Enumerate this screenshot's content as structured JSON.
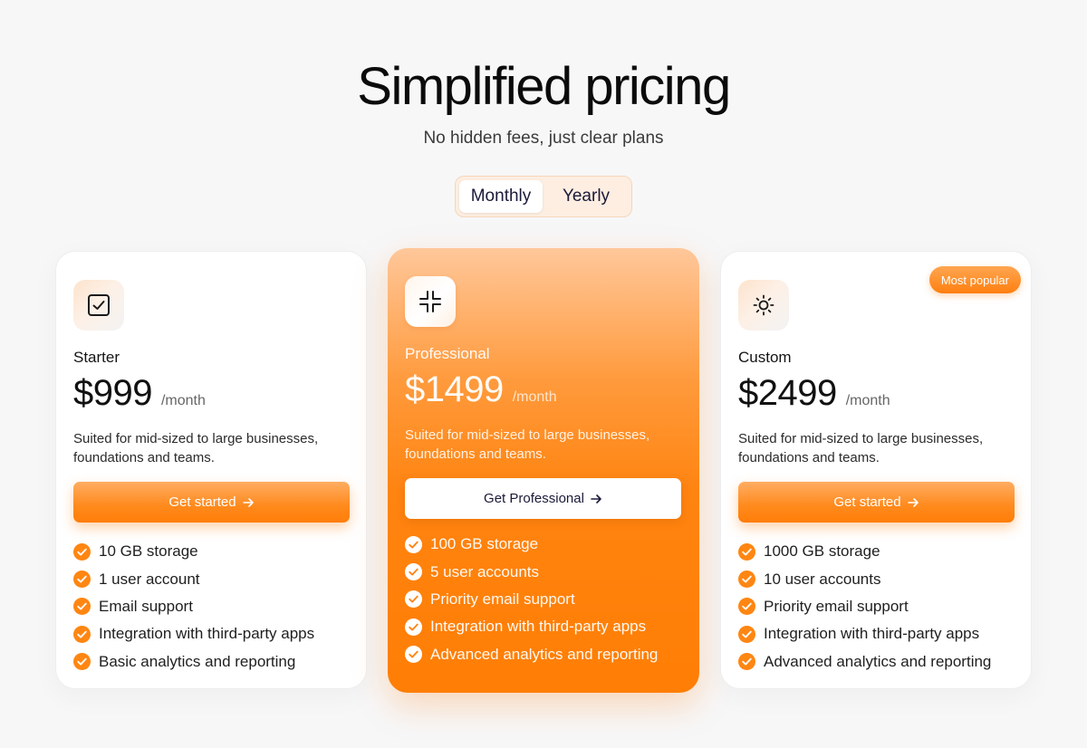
{
  "header": {
    "title": "Simplified pricing",
    "subtitle": "No hidden fees, just clear plans"
  },
  "billing_toggle": {
    "options": [
      "Monthly",
      "Yearly"
    ],
    "selected": "Monthly"
  },
  "colors": {
    "accent": "#ff8410",
    "background": "#f7f7f8"
  },
  "plans": [
    {
      "icon": "checkbox-icon",
      "name": "Starter",
      "price": "$999",
      "period": "/month",
      "description": "Suited for mid-sized to large businesses, foundations and teams.",
      "cta": "Get started",
      "features": [
        "10 GB storage",
        "1 user account",
        "Email support",
        "Integration with third-party apps",
        "Basic analytics and reporting"
      ]
    },
    {
      "icon": "collapse-icon",
      "name": "Professional",
      "price": "$1499",
      "period": "/month",
      "description": "Suited for mid-sized to large businesses, foundations and teams.",
      "cta": "Get Professional",
      "features": [
        "100 GB storage",
        "5 user accounts",
        "Priority email support",
        "Integration with third-party apps",
        "Advanced analytics and reporting"
      ]
    },
    {
      "icon": "sun-icon",
      "name": "Custom",
      "badge": "Most popular",
      "price": "$2499",
      "period": "/month",
      "description": "Suited for mid-sized to large businesses, foundations and teams.",
      "cta": "Get started",
      "features": [
        "1000 GB storage",
        "10 user accounts",
        "Priority email support",
        "Integration with third-party apps",
        "Advanced analytics and reporting"
      ]
    }
  ]
}
